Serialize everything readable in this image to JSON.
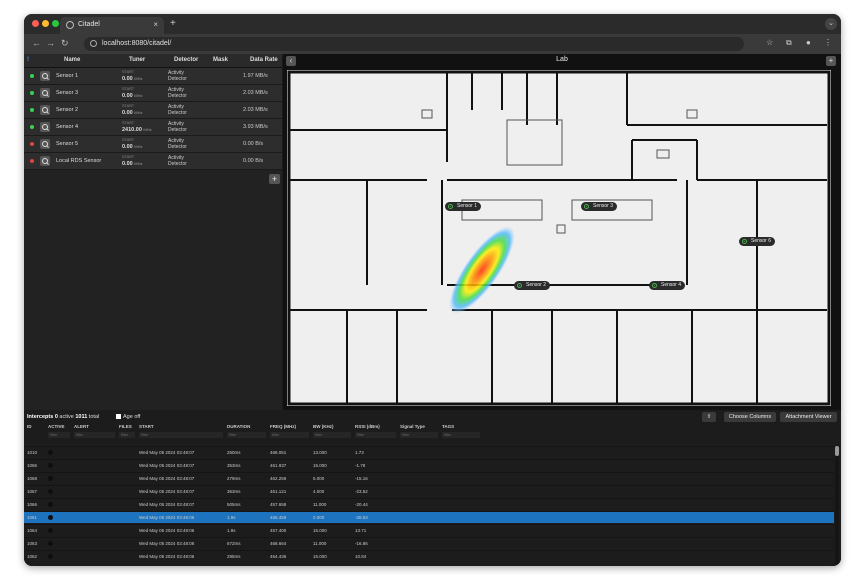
{
  "browser": {
    "tab_title": "Citadel",
    "url": "localhost:8080/citadel/",
    "colors": {
      "close": "#ff5f57",
      "minimize": "#febc2e",
      "maximize": "#28c840"
    },
    "icons": [
      "chrome-icon",
      "close-icon",
      "plus-icon",
      "back-icon",
      "forward-icon",
      "reload-icon",
      "info-icon",
      "star-icon",
      "extensions-icon",
      "profile-icon",
      "menu-icon",
      "chevron-down-icon"
    ]
  },
  "sensors": {
    "columns": {
      "marker": "!",
      "name": "Name",
      "tuner": "Tuner",
      "detector": "Detector",
      "mask": "Mask",
      "rate": "Data Rate"
    },
    "rows": [
      {
        "status": "green",
        "name": "Sensor 1",
        "tuner_label": "START",
        "tuner_value": "0.00",
        "tuner_unit": "MHz",
        "detector": "Activity Detector",
        "rate": "1.97 MB/s"
      },
      {
        "status": "green",
        "name": "Sensor 3",
        "tuner_label": "START",
        "tuner_value": "0.00",
        "tuner_unit": "MHz",
        "detector": "Activity Detector",
        "rate": "2.03 MB/s"
      },
      {
        "status": "green",
        "name": "Sensor 2",
        "tuner_label": "START",
        "tuner_value": "0.00",
        "tuner_unit": "MHz",
        "detector": "Activity Detector",
        "rate": "2.03 MB/s"
      },
      {
        "status": "green",
        "name": "Sensor 4",
        "tuner_label": "START",
        "tuner_value": "2410.00",
        "tuner_unit": "MHz",
        "detector": "Activity Detector",
        "rate": "3.93 MB/s"
      },
      {
        "status": "red",
        "name": "Sensor 5",
        "tuner_label": "START",
        "tuner_value": "0.00",
        "tuner_unit": "MHz",
        "detector": "Activity Detector",
        "rate": "0.00 B/s"
      },
      {
        "status": "red",
        "name": "Local RDS Sensor",
        "tuner_label": "START",
        "tuner_value": "0.00",
        "tuner_unit": "MHz",
        "detector": "Activity Detector",
        "rate": "0.00 B/s"
      }
    ],
    "add_label": "+",
    "status_colors": {
      "green": "#39d353",
      "red": "#e0443e"
    }
  },
  "map": {
    "title": "Lab",
    "collapse_label": "‹",
    "add_label": "+",
    "markers": [
      "Sensor 1",
      "Sensor 3",
      "Sensor 6",
      "Sensor 2",
      "Sensor 4"
    ]
  },
  "intercepts": {
    "label": "Intercepts",
    "active_count": "0",
    "active_label": "active",
    "total_count": "1011",
    "total_label": "total",
    "age_off_label": "Age off",
    "buttons": {
      "choose_columns": "Choose Columns",
      "attachment_viewer": "Attachment Viewer"
    },
    "columns": [
      "ID",
      "ACTIVE",
      "ALERT",
      "FILES",
      "START",
      "DURATION",
      "FREQ (MHz)",
      "BW (KHz)",
      "RSSI (dBm)",
      "Signal Type",
      "TAGS"
    ],
    "filter_placeholder": "filter",
    "highlight_color": "#1e73be",
    "rows": [
      {
        "id": "1010",
        "start": "Wed May 05 2024 03:48:07",
        "duration": "250ms",
        "freq": "468.051",
        "bw": "13.000",
        "rssi": "1.73"
      },
      {
        "id": "1065",
        "start": "Wed May 05 2024 03:48:07",
        "duration": "353ms",
        "freq": "461.937",
        "bw": "15.000",
        "rssi": "-1.78"
      },
      {
        "id": "1068",
        "start": "Wed May 05 2024 03:48:07",
        "duration": "279ms",
        "freq": "462.259",
        "bw": "5.000",
        "rssi": "-15.16"
      },
      {
        "id": "1067",
        "start": "Wed May 05 2024 03:48:07",
        "duration": "363ms",
        "freq": "461.121",
        "bw": "4.000",
        "rssi": "-23.52"
      },
      {
        "id": "1066",
        "start": "Wed May 05 2024 03:48:07",
        "duration": "505ms",
        "freq": "457.658",
        "bw": "11.000",
        "rssi": "-20.44"
      },
      {
        "id": "1061",
        "start": "Wed May 05 2024 03:48:06",
        "duration": "1.9s",
        "freq": "456.459",
        "bw": "2.000",
        "rssi": "-28.53",
        "selected": true
      },
      {
        "id": "1064",
        "start": "Wed May 05 2024 03:48:06",
        "duration": "1.9s",
        "freq": "457.400",
        "bw": "15.000",
        "rssi": "13.71"
      },
      {
        "id": "1063",
        "start": "Wed May 05 2024 03:48:06",
        "duration": "672ms",
        "freq": "468.664",
        "bw": "11.000",
        "rssi": "-16.86"
      },
      {
        "id": "1062",
        "start": "Wed May 05 2024 03:48:06",
        "duration": "295ms",
        "freq": "464.436",
        "bw": "15.000",
        "rssi": "10.84"
      }
    ]
  }
}
